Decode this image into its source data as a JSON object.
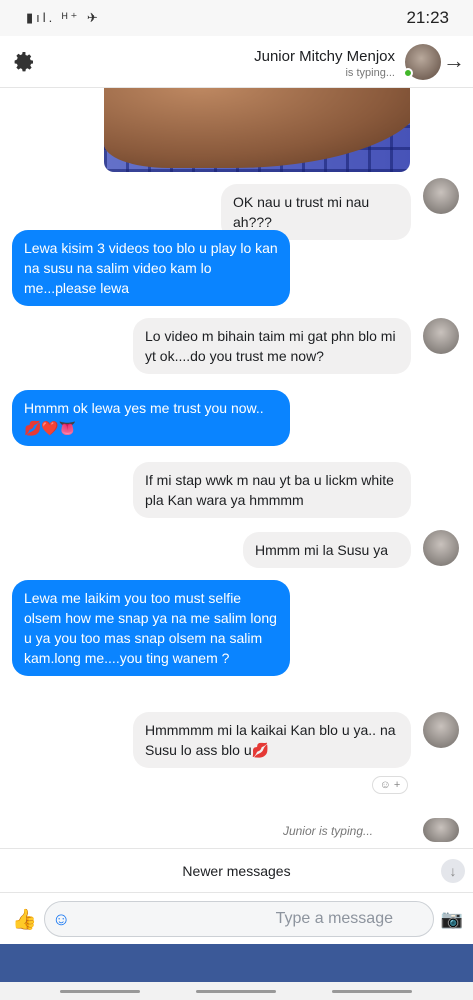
{
  "status_bar": {
    "time": "21:23",
    "icons": "▮ıl. ᴴ⁺ ✈"
  },
  "header": {
    "name": "Junior Mitchy Menjox",
    "status": "is typing...",
    "back_arrow": "→"
  },
  "messages": [
    {
      "side": "in",
      "text": "OK nau u trust mi nau ah???"
    },
    {
      "side": "out",
      "text": "Lewa kisim 3 videos too blo u play lo kan na susu na salim video kam lo me...please lewa"
    },
    {
      "side": "in",
      "text": "Lo video m bihain taim mi gat phn blo mi yt ok....do you trust me now?"
    },
    {
      "side": "out",
      "text": "Hmmm ok lewa yes me trust you now..💋❤️👅"
    },
    {
      "side": "in",
      "text": "If mi stap wwk m nau yt ba u lickm white pla Kan wara ya hmmmm"
    },
    {
      "side": "in",
      "text": "Hmmm mi la Susu ya"
    },
    {
      "side": "out",
      "text": "Lewa me laikim you too must selfie olsem how me snap ya na me salim long u ya you too mas snap olsem na salim kam.long me....you ting wanem ?"
    },
    {
      "side": "in",
      "text": "Hmmmmm mi la kaikai Kan blo u ya.. na Susu lo ass blo u💋"
    }
  ],
  "reaction": "☺ +",
  "typing": "Junior is typing...",
  "newer_messages": "Newer messages",
  "composer": {
    "placeholder": "Type a message"
  },
  "icons": {
    "settings": "gear-icon",
    "like": "thumbs-up-icon",
    "emoji": "emoji-icon",
    "camera": "camera-icon",
    "down": "arrow-down-icon"
  },
  "colors": {
    "outgoing": "#0a84ff",
    "incoming": "#f1f0f0",
    "brand": "#3b5998",
    "online": "#42b72a"
  }
}
